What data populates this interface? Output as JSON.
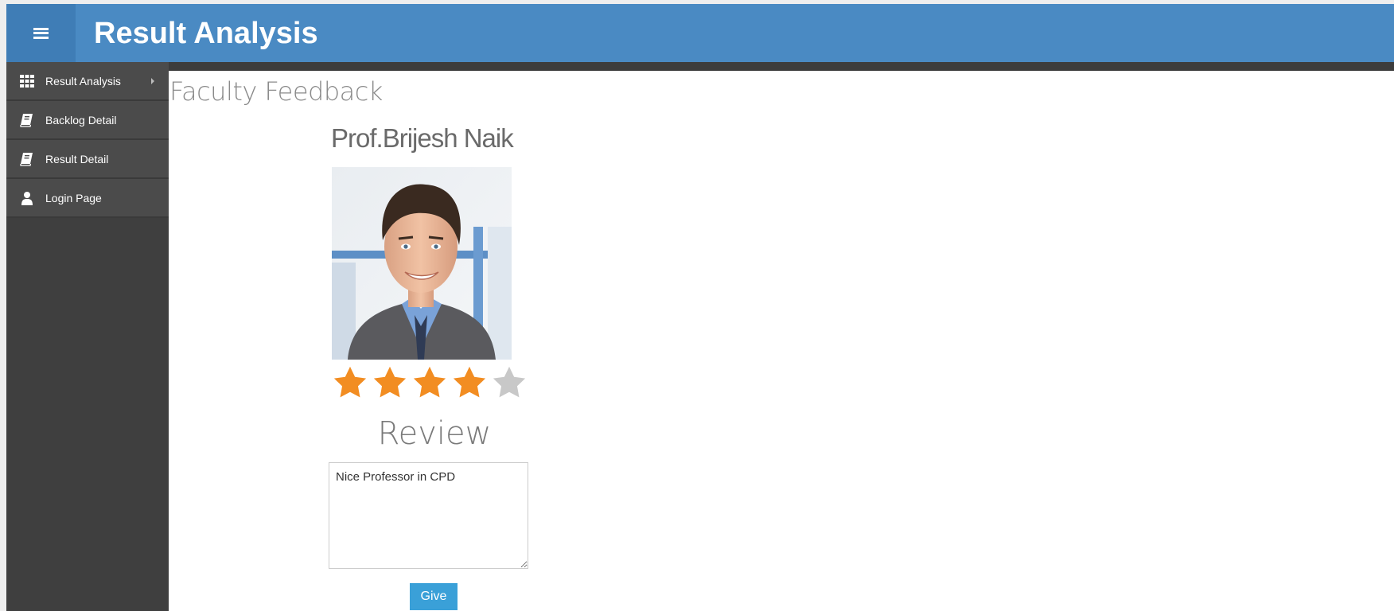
{
  "header": {
    "title": "Result Analysis",
    "menu_icon": "hamburger-icon"
  },
  "sidebar": {
    "items": [
      {
        "label": "Result Analysis",
        "icon": "grid-icon",
        "has_submenu": true
      },
      {
        "label": "Backlog Detail",
        "icon": "book-icon",
        "has_submenu": false
      },
      {
        "label": "Result Detail",
        "icon": "book-icon",
        "has_submenu": false
      },
      {
        "label": "Login Page",
        "icon": "user-icon",
        "has_submenu": false
      }
    ]
  },
  "main": {
    "page_title": "Faculty Feedback",
    "faculty": {
      "name": "Prof.Brijesh Naik",
      "photo": "faculty-photo"
    },
    "rating": {
      "value": 4,
      "max": 5,
      "filled_color": "#f28d22",
      "empty_color": "#c8c8c8"
    },
    "review": {
      "heading": "Review",
      "text": "Nice Professor in CPD"
    },
    "submit_label": "Give"
  },
  "colors": {
    "header_bg": "#4a8ac3",
    "sidebar_bg": "#3f3f3f",
    "button_bg": "#3aa0d8"
  }
}
